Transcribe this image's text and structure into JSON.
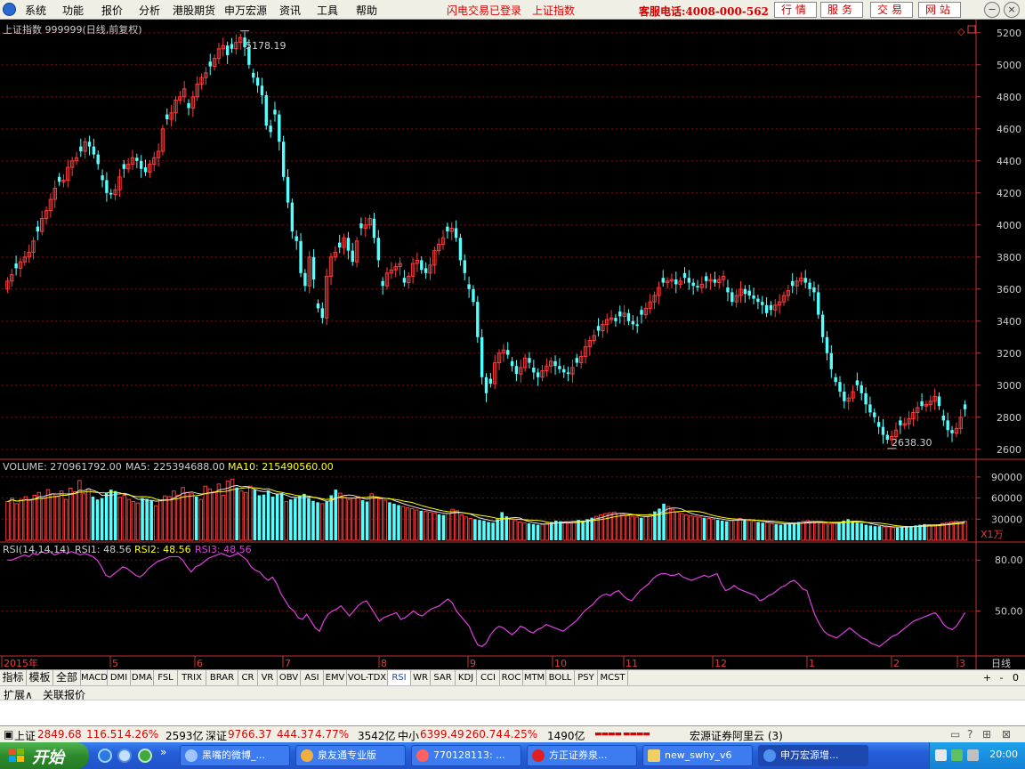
{
  "menubar": {
    "items": [
      "系统",
      "功能",
      "报价",
      "分析",
      "港股期货",
      "申万宏源",
      "资讯",
      "工具",
      "帮助"
    ],
    "flash_status": "闪电交易已登录",
    "current_index": "上证指数",
    "hotline": "客服电话:4008-000-562",
    "tabs": [
      "行情",
      "服务",
      "交易",
      "网站"
    ]
  },
  "price_panel": {
    "title": "上证指数  999999(日线,前复权)",
    "high_label": "5178.19",
    "low_label": "2638.30",
    "y_ticks": [
      "5200",
      "5000",
      "4800",
      "4600",
      "4400",
      "4200",
      "4000",
      "3800",
      "3600",
      "3400",
      "3200",
      "3000",
      "2800",
      "2600"
    ]
  },
  "volume_panel": {
    "label": "VOLUME: 270961792.00",
    "ma5": "MA5: 225394688.00",
    "ma10": "MA10: 215490560.00",
    "y_ticks": [
      "90000",
      "60000",
      "30000"
    ],
    "unit": "X1万"
  },
  "rsi_panel": {
    "label": "RSI(14,14,14)",
    "rsi1": "RSI1: 48.56",
    "rsi2": "RSI2: 48.56",
    "rsi3": "RSI3: 48.56",
    "y_ticks": [
      "80.00",
      "50.00"
    ]
  },
  "time_axis": {
    "labels": [
      "2015年",
      "5",
      "6",
      "7",
      "8",
      "9",
      "10",
      "11",
      "12",
      "1",
      "2",
      "3"
    ],
    "period": "日线"
  },
  "indicator_tabs": [
    "指标",
    "模板",
    "全部",
    "MACD",
    "DMI",
    "DMA",
    "FSL",
    "TRIX",
    "BRAR",
    "CR",
    "VR",
    "OBV",
    "ASI",
    "EMV",
    "VOL-TDX",
    "RSI",
    "WR",
    "SAR",
    "KDJ",
    "CCI",
    "ROC",
    "MTM",
    "BOLL",
    "PSY",
    "MCST"
  ],
  "active_indicator": "RSI",
  "ext_tabs": [
    "扩展∧",
    "关联报价"
  ],
  "statusbar": {
    "sh_label": "上证",
    "sh_value": "2849.68",
    "sh_change": "116.51",
    "sh_pct": "4.26%",
    "sh_amount": "2593亿",
    "sz_label": "深证",
    "sz_value": "9766.37",
    "sz_change": "444.37",
    "sz_pct": "4.77%",
    "sz_amount": "3542亿",
    "zx_label": "中小",
    "zx_value": "6399.49",
    "zx_change": "260.74",
    "zx_pct": "4.25%",
    "zx_amount": "1490亿",
    "server": "宏源证券阿里云 (3)"
  },
  "taskbar": {
    "start": "开始",
    "tasks": [
      "黑嘴的微博_...",
      "泉友通专业版",
      "770128113: ...",
      "方正证券泉...",
      "new_swhy_v6",
      "申万宏源增..."
    ],
    "clock": "20:00"
  },
  "chart_data": [
    {
      "type": "candlestick",
      "title": "上证指数 999999(日线,前复权)",
      "x_axis_labels": [
        "2015年",
        "5",
        "6",
        "7",
        "8",
        "9",
        "10",
        "11",
        "12",
        "1",
        "2",
        "3"
      ],
      "ylim": [
        2560,
        5260
      ],
      "annotations": [
        {
          "label": "5178.19",
          "value": 5178.19
        },
        {
          "label": "2638.30",
          "value": 2638.3
        }
      ],
      "close": [
        3650,
        3690,
        3730,
        3770,
        3800,
        3830,
        3900,
        3960,
        4040,
        4090,
        4160,
        4230,
        4270,
        4280,
        4360,
        4400,
        4420,
        4460,
        4520,
        4490,
        4440,
        4380,
        4280,
        4200,
        4190,
        4220,
        4300,
        4350,
        4380,
        4420,
        4400,
        4350,
        4330,
        4380,
        4420,
        4460,
        4600,
        4660,
        4700,
        4780,
        4800,
        4850,
        4730,
        4800,
        4880,
        4920,
        4950,
        4990,
        5040,
        5100,
        5120,
        5060,
        5100,
        5140,
        5170,
        5110,
        5000,
        4920,
        4870,
        4810,
        4620,
        4580,
        4690,
        4520,
        4300,
        4140,
        3960,
        3900,
        3700,
        3620,
        3800,
        3660,
        3480,
        3420,
        3680,
        3800,
        3830,
        3860,
        3920,
        3840,
        3770,
        3900,
        3980,
        4000,
        4040,
        3920,
        3780,
        3620,
        3700,
        3720,
        3740,
        3760,
        3640,
        3680,
        3760,
        3780,
        3720,
        3700,
        3750,
        3840,
        3880,
        3920,
        3960,
        3980,
        3920,
        3780,
        3700,
        3600,
        3520,
        3300,
        3050,
        2950,
        3010,
        3140,
        3200,
        3220,
        3190,
        3120,
        3070,
        3110,
        3170,
        3140,
        3080,
        3050,
        3090,
        3120,
        3150,
        3120,
        3100,
        3080,
        3070,
        3110,
        3140,
        3180,
        3240,
        3280,
        3310,
        3340,
        3380,
        3410,
        3420,
        3400,
        3430,
        3450,
        3400,
        3380,
        3370,
        3440,
        3480,
        3520,
        3560,
        3610,
        3640,
        3650,
        3660,
        3630,
        3650,
        3670,
        3640,
        3620,
        3610,
        3630,
        3650,
        3660,
        3640,
        3660,
        3680,
        3580,
        3520,
        3560,
        3600,
        3570,
        3560,
        3540,
        3520,
        3500,
        3450,
        3470,
        3500,
        3520,
        3560,
        3590,
        3620,
        3650,
        3670,
        3640,
        3600,
        3580,
        3440,
        3300,
        3200,
        3100,
        3020,
        2960,
        2900,
        2920,
        2960,
        3000,
        2950,
        2880,
        2830,
        2800,
        2740,
        2690,
        2660,
        2680,
        2720,
        2750,
        2760,
        2790,
        2830,
        2860,
        2870,
        2880,
        2900,
        2930,
        2870,
        2780,
        2720,
        2700,
        2730,
        2800,
        2850
      ]
    },
    {
      "type": "bar",
      "title": "VOLUME",
      "unit": "X1万",
      "ylim": [
        0,
        100000
      ],
      "series": [
        {
          "name": "VOLUME"
        },
        {
          "name": "MA5"
        },
        {
          "name": "MA10"
        }
      ],
      "values": [
        55000,
        60000,
        52000,
        58000,
        62000,
        57000,
        64000,
        68000,
        60000,
        72000,
        66000,
        63000,
        70000,
        58000,
        74000,
        69000,
        85000,
        66000,
        73000,
        62000,
        58000,
        60000,
        67000,
        72000,
        70000,
        61000,
        64000,
        58000,
        55000,
        53000,
        60000,
        59000,
        57000,
        49000,
        56000,
        63000,
        62000,
        70000,
        64000,
        75000,
        68000,
        66000,
        62000,
        58000,
        77000,
        73000,
        69000,
        80000,
        64000,
        84000,
        87000,
        75000,
        70000,
        68000,
        77000,
        72000,
        64000,
        65000,
        71000,
        62000,
        66000,
        67000,
        55000,
        58000,
        60000,
        63000,
        66000,
        60000,
        56000,
        54000,
        52000,
        55000,
        64000,
        72000,
        67000,
        61000,
        58000,
        60000,
        62000,
        57000,
        55000,
        66000,
        61000,
        59000,
        57000,
        54000,
        52000,
        50000,
        48000,
        46000,
        45000,
        43000,
        42000,
        41000,
        40000,
        39000,
        37000,
        36000,
        38000,
        44000,
        42000,
        36000,
        33000,
        31000,
        30000,
        29000,
        28000,
        26000,
        25000,
        30000,
        40000,
        34000,
        30000,
        28000,
        26000,
        25000,
        24000,
        23000,
        22000,
        22000,
        24000,
        26000,
        28000,
        27000,
        26000,
        25000,
        27000,
        29000,
        28000,
        30000,
        32000,
        34000,
        36000,
        38000,
        39000,
        40000,
        38000,
        37000,
        35000,
        34000,
        33000,
        32000,
        34000,
        37000,
        41000,
        45000,
        52000,
        48000,
        44000,
        40000,
        38000,
        36000,
        35000,
        34000,
        33000,
        32000,
        31000,
        30000,
        29000,
        28000,
        27000,
        28000,
        30000,
        31000,
        29000,
        28000,
        27000,
        26000,
        25000,
        25000,
        24000,
        23000,
        22000,
        23000,
        24000,
        25000,
        26000,
        27000,
        28000,
        27000,
        26000,
        25000,
        24000,
        23000,
        24000,
        26000,
        28000,
        30000,
        27000,
        25000,
        24000,
        22000,
        21000,
        20000,
        20000,
        19000,
        19000,
        18000,
        18000,
        19000,
        20000,
        20000,
        21000,
        22000,
        23000,
        22000,
        21000,
        22000,
        24000,
        25000,
        26000,
        27000,
        26000,
        27000
      ]
    },
    {
      "type": "line",
      "title": "RSI(14,14,14)",
      "series": [
        {
          "name": "RSI1"
        },
        {
          "name": "RSI2"
        },
        {
          "name": "RSI3"
        }
      ],
      "ylim": [
        25,
        88
      ],
      "values": [
        80,
        80,
        81,
        82,
        83,
        82,
        84,
        83,
        85,
        84,
        85,
        83,
        84,
        85,
        84,
        85,
        84,
        83,
        84,
        83,
        82,
        80,
        76,
        71,
        70,
        72,
        74,
        76,
        75,
        73,
        71,
        70,
        72,
        75,
        77,
        79,
        80,
        81,
        82,
        82,
        82,
        80,
        76,
        73,
        76,
        77,
        79,
        81,
        82,
        83,
        84,
        83,
        82,
        83,
        84,
        82,
        80,
        76,
        74,
        73,
        70,
        68,
        70,
        66,
        60,
        56,
        52,
        50,
        46,
        45,
        48,
        44,
        40,
        38,
        44,
        48,
        50,
        51,
        53,
        50,
        47,
        50,
        53,
        55,
        56,
        52,
        48,
        44,
        46,
        47,
        48,
        49,
        45,
        46,
        48,
        50,
        48,
        47,
        49,
        51,
        52,
        53,
        55,
        57,
        55,
        50,
        47,
        44,
        41,
        35,
        30,
        29,
        31,
        36,
        39,
        41,
        40,
        38,
        36,
        38,
        41,
        40,
        38,
        37,
        39,
        40,
        42,
        41,
        40,
        39,
        38,
        40,
        42,
        44,
        47,
        50,
        52,
        54,
        57,
        59,
        60,
        59,
        61,
        62,
        59,
        57,
        56,
        59,
        62,
        64,
        66,
        69,
        71,
        72,
        72,
        71,
        71,
        72,
        70,
        69,
        68,
        69,
        70,
        71,
        70,
        71,
        72,
        66,
        62,
        63,
        65,
        63,
        62,
        61,
        60,
        59,
        56,
        57,
        59,
        60,
        62,
        64,
        65,
        67,
        68,
        66,
        63,
        62,
        54,
        47,
        42,
        38,
        36,
        35,
        34,
        36,
        38,
        40,
        38,
        36,
        34,
        33,
        31,
        30,
        29,
        31,
        33,
        35,
        36,
        38,
        40,
        42,
        44,
        45,
        46,
        47,
        48,
        49,
        46,
        42,
        40,
        39,
        41,
        45,
        49
      ]
    }
  ]
}
